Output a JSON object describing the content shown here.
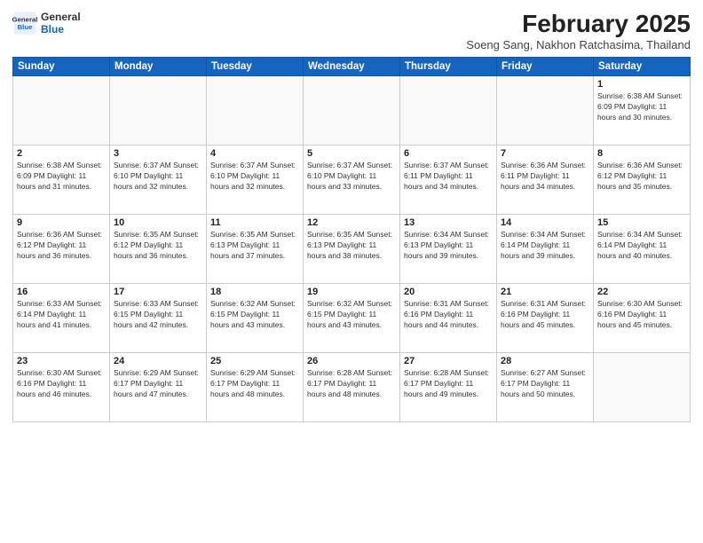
{
  "header": {
    "logo_line1": "General",
    "logo_line2": "Blue",
    "title": "February 2025",
    "subtitle": "Soeng Sang, Nakhon Ratchasima, Thailand"
  },
  "weekdays": [
    "Sunday",
    "Monday",
    "Tuesday",
    "Wednesday",
    "Thursday",
    "Friday",
    "Saturday"
  ],
  "weeks": [
    [
      {
        "day": "",
        "info": ""
      },
      {
        "day": "",
        "info": ""
      },
      {
        "day": "",
        "info": ""
      },
      {
        "day": "",
        "info": ""
      },
      {
        "day": "",
        "info": ""
      },
      {
        "day": "",
        "info": ""
      },
      {
        "day": "1",
        "info": "Sunrise: 6:38 AM\nSunset: 6:09 PM\nDaylight: 11 hours\nand 30 minutes."
      }
    ],
    [
      {
        "day": "2",
        "info": "Sunrise: 6:38 AM\nSunset: 6:09 PM\nDaylight: 11 hours\nand 31 minutes."
      },
      {
        "day": "3",
        "info": "Sunrise: 6:37 AM\nSunset: 6:10 PM\nDaylight: 11 hours\nand 32 minutes."
      },
      {
        "day": "4",
        "info": "Sunrise: 6:37 AM\nSunset: 6:10 PM\nDaylight: 11 hours\nand 32 minutes."
      },
      {
        "day": "5",
        "info": "Sunrise: 6:37 AM\nSunset: 6:10 PM\nDaylight: 11 hours\nand 33 minutes."
      },
      {
        "day": "6",
        "info": "Sunrise: 6:37 AM\nSunset: 6:11 PM\nDaylight: 11 hours\nand 34 minutes."
      },
      {
        "day": "7",
        "info": "Sunrise: 6:36 AM\nSunset: 6:11 PM\nDaylight: 11 hours\nand 34 minutes."
      },
      {
        "day": "8",
        "info": "Sunrise: 6:36 AM\nSunset: 6:12 PM\nDaylight: 11 hours\nand 35 minutes."
      }
    ],
    [
      {
        "day": "9",
        "info": "Sunrise: 6:36 AM\nSunset: 6:12 PM\nDaylight: 11 hours\nand 36 minutes."
      },
      {
        "day": "10",
        "info": "Sunrise: 6:35 AM\nSunset: 6:12 PM\nDaylight: 11 hours\nand 36 minutes."
      },
      {
        "day": "11",
        "info": "Sunrise: 6:35 AM\nSunset: 6:13 PM\nDaylight: 11 hours\nand 37 minutes."
      },
      {
        "day": "12",
        "info": "Sunrise: 6:35 AM\nSunset: 6:13 PM\nDaylight: 11 hours\nand 38 minutes."
      },
      {
        "day": "13",
        "info": "Sunrise: 6:34 AM\nSunset: 6:13 PM\nDaylight: 11 hours\nand 39 minutes."
      },
      {
        "day": "14",
        "info": "Sunrise: 6:34 AM\nSunset: 6:14 PM\nDaylight: 11 hours\nand 39 minutes."
      },
      {
        "day": "15",
        "info": "Sunrise: 6:34 AM\nSunset: 6:14 PM\nDaylight: 11 hours\nand 40 minutes."
      }
    ],
    [
      {
        "day": "16",
        "info": "Sunrise: 6:33 AM\nSunset: 6:14 PM\nDaylight: 11 hours\nand 41 minutes."
      },
      {
        "day": "17",
        "info": "Sunrise: 6:33 AM\nSunset: 6:15 PM\nDaylight: 11 hours\nand 42 minutes."
      },
      {
        "day": "18",
        "info": "Sunrise: 6:32 AM\nSunset: 6:15 PM\nDaylight: 11 hours\nand 43 minutes."
      },
      {
        "day": "19",
        "info": "Sunrise: 6:32 AM\nSunset: 6:15 PM\nDaylight: 11 hours\nand 43 minutes."
      },
      {
        "day": "20",
        "info": "Sunrise: 6:31 AM\nSunset: 6:16 PM\nDaylight: 11 hours\nand 44 minutes."
      },
      {
        "day": "21",
        "info": "Sunrise: 6:31 AM\nSunset: 6:16 PM\nDaylight: 11 hours\nand 45 minutes."
      },
      {
        "day": "22",
        "info": "Sunrise: 6:30 AM\nSunset: 6:16 PM\nDaylight: 11 hours\nand 45 minutes."
      }
    ],
    [
      {
        "day": "23",
        "info": "Sunrise: 6:30 AM\nSunset: 6:16 PM\nDaylight: 11 hours\nand 46 minutes."
      },
      {
        "day": "24",
        "info": "Sunrise: 6:29 AM\nSunset: 6:17 PM\nDaylight: 11 hours\nand 47 minutes."
      },
      {
        "day": "25",
        "info": "Sunrise: 6:29 AM\nSunset: 6:17 PM\nDaylight: 11 hours\nand 48 minutes."
      },
      {
        "day": "26",
        "info": "Sunrise: 6:28 AM\nSunset: 6:17 PM\nDaylight: 11 hours\nand 48 minutes."
      },
      {
        "day": "27",
        "info": "Sunrise: 6:28 AM\nSunset: 6:17 PM\nDaylight: 11 hours\nand 49 minutes."
      },
      {
        "day": "28",
        "info": "Sunrise: 6:27 AM\nSunset: 6:17 PM\nDaylight: 11 hours\nand 50 minutes."
      },
      {
        "day": "",
        "info": ""
      }
    ]
  ]
}
